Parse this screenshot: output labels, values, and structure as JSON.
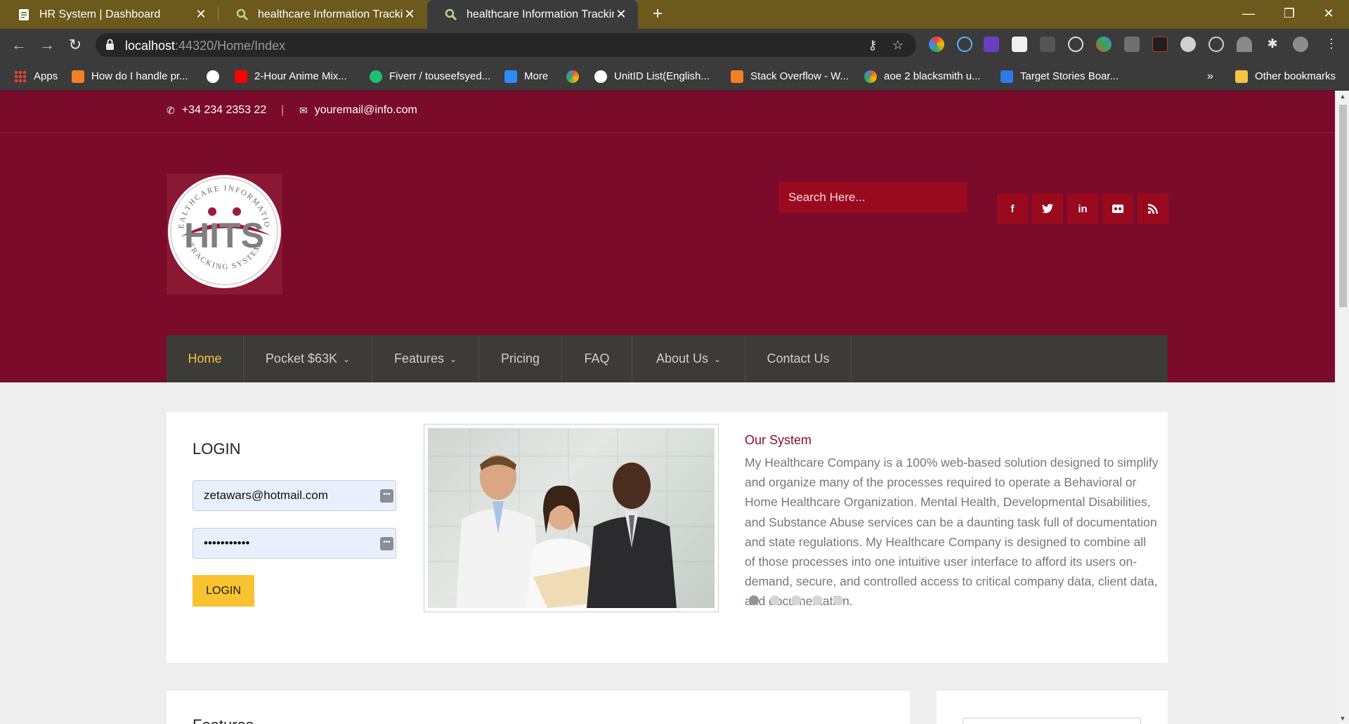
{
  "browser": {
    "tabs": [
      {
        "title": "HR System | Dashboard",
        "active": false,
        "icon": "document-icon"
      },
      {
        "title": "healthcare Information Tracking S",
        "active": false,
        "icon": "search-icon"
      },
      {
        "title": "healthcare Information Tracking S",
        "active": true,
        "icon": "search-icon"
      }
    ],
    "new_tab": "+",
    "url_host": "localhost",
    "url_rest": ":44320/Home/Index",
    "bookmarks": [
      {
        "label": "Apps",
        "color": "#e94235"
      },
      {
        "label": "How do I handle pr...",
        "color": "#f48024"
      },
      {
        "label": "",
        "color": "#ffffff"
      },
      {
        "label": "2-Hour Anime Mix...",
        "color": "#ff0000"
      },
      {
        "label": "Fiverr / touseefsyed...",
        "color": "#1dbf73"
      },
      {
        "label": "More",
        "color": "#2d8cff"
      },
      {
        "label": "",
        "color": "#4285f4"
      },
      {
        "label": "UnitID List(English...",
        "color": "#ffffff"
      },
      {
        "label": "Stack Overflow - W...",
        "color": "#f48024"
      },
      {
        "label": "aoe 2 blacksmith u...",
        "color": "#4285f4"
      },
      {
        "label": "Target Stories Boar...",
        "color": "#2d7be5"
      }
    ],
    "bookmarks_overflow": "»",
    "other_bookmarks": "Other bookmarks"
  },
  "page": {
    "phone": "+34 234 2353 22",
    "separator": "|",
    "email": "youremail@info.com",
    "search_placeholder": "Search Here...",
    "logo": {
      "ring_top": "HEALTHCARE INFORMATION",
      "ring_bottom": "TRACKING SYSTEM",
      "wordmark": "HITS"
    },
    "social": [
      "f",
      "t",
      "in",
      "fl",
      "rss"
    ],
    "nav": [
      {
        "label": "Home",
        "active": true,
        "dropdown": false
      },
      {
        "label": "Pocket $63K",
        "active": false,
        "dropdown": true
      },
      {
        "label": "Features",
        "active": false,
        "dropdown": true
      },
      {
        "label": "Pricing",
        "active": false,
        "dropdown": false
      },
      {
        "label": "FAQ",
        "active": false,
        "dropdown": false
      },
      {
        "label": "About Us",
        "active": false,
        "dropdown": true
      },
      {
        "label": "Contact Us",
        "active": false,
        "dropdown": false
      }
    ],
    "login": {
      "title": "LOGIN",
      "email_value": "zetawars@hotmail.com",
      "password_value": "•••••••••••",
      "button": "LOGIN"
    },
    "system": {
      "title": "Our System",
      "body": "My Healthcare Company is a 100% web-based solution designed to simplify and organize many of the processes required to operate a Behavioral or Home Healthcare Organization. Mental Health, Developmental Disabilities, and Substance Abuse services can be a daunting task full of documentation and state regulations. My Healthcare Company is designed to combine all of those processes into one intuitive user interface to afford its users on-demand, secure, and controlled access to critical company data, client data, and documentation."
    },
    "carousel": {
      "count": 5,
      "active_index": 0
    },
    "features_heading": "Features"
  },
  "colors": {
    "brand": "#7a0b2b",
    "accent": "#f5c142",
    "nav_bg": "#3d3b37",
    "button": "#f9c32f"
  }
}
